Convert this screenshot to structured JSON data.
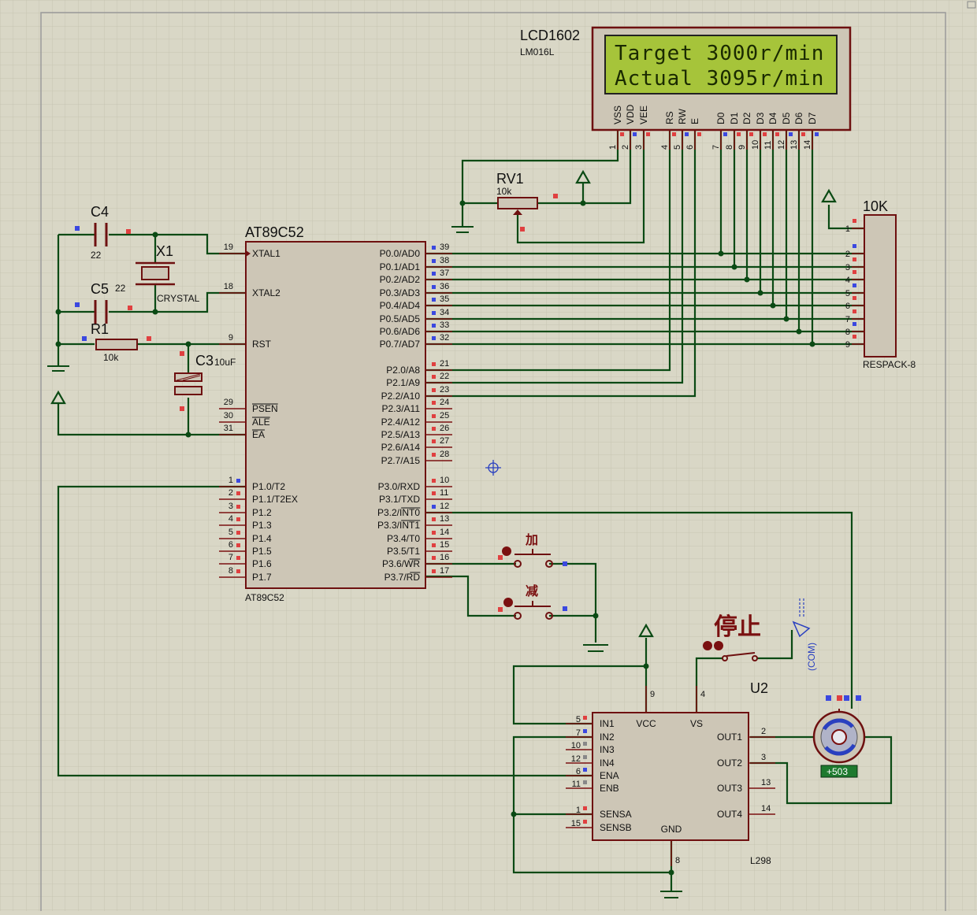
{
  "mcu": {
    "designator": "AT89C52",
    "part": "AT89C52",
    "left_pins": [
      {
        "num": "19",
        "name": "XTAL1"
      },
      {
        "num": "18",
        "name": "XTAL2"
      },
      {
        "num": "9",
        "name": "RST"
      },
      {
        "num": "29",
        "name": "PSEN"
      },
      {
        "num": "30",
        "name": "ALE"
      },
      {
        "num": "31",
        "name": "EA"
      },
      {
        "num": "1",
        "name": "P1.0/T2"
      },
      {
        "num": "2",
        "name": "P1.1/T2EX"
      },
      {
        "num": "3",
        "name": "P1.2"
      },
      {
        "num": "4",
        "name": "P1.3"
      },
      {
        "num": "5",
        "name": "P1.4"
      },
      {
        "num": "6",
        "name": "P1.5"
      },
      {
        "num": "7",
        "name": "P1.6"
      },
      {
        "num": "8",
        "name": "P1.7"
      }
    ],
    "right_pins": [
      {
        "num": "39",
        "name": "P0.0/AD0"
      },
      {
        "num": "38",
        "name": "P0.1/AD1"
      },
      {
        "num": "37",
        "name": "P0.2/AD2"
      },
      {
        "num": "36",
        "name": "P0.3/AD3"
      },
      {
        "num": "35",
        "name": "P0.4/AD4"
      },
      {
        "num": "34",
        "name": "P0.5/AD5"
      },
      {
        "num": "33",
        "name": "P0.6/AD6"
      },
      {
        "num": "32",
        "name": "P0.7/AD7"
      },
      {
        "num": "21",
        "name": "P2.0/A8"
      },
      {
        "num": "22",
        "name": "P2.1/A9"
      },
      {
        "num": "23",
        "name": "P2.2/A10"
      },
      {
        "num": "24",
        "name": "P2.3/A11"
      },
      {
        "num": "25",
        "name": "P2.4/A12"
      },
      {
        "num": "26",
        "name": "P2.5/A13"
      },
      {
        "num": "27",
        "name": "P2.6/A14"
      },
      {
        "num": "28",
        "name": "P2.7/A15"
      },
      {
        "num": "10",
        "name": "P3.0/RXD"
      },
      {
        "num": "11",
        "name": "P3.1/TXD"
      },
      {
        "num": "12",
        "name": "P3.2/INT0"
      },
      {
        "num": "13",
        "name": "P3.3/INT1"
      },
      {
        "num": "14",
        "name": "P3.4/T0"
      },
      {
        "num": "15",
        "name": "P3.5/T1"
      },
      {
        "num": "16",
        "name": "P3.6/WR"
      },
      {
        "num": "17",
        "name": "P3.7/RD"
      }
    ]
  },
  "lcd": {
    "designator": "LCD1602",
    "part": "LM016L",
    "line1": "Target 3000r/min",
    "line2": "Actual 3095r/min",
    "pins": [
      {
        "num": "1",
        "name": "VSS"
      },
      {
        "num": "2",
        "name": "VDD"
      },
      {
        "num": "3",
        "name": "VEE"
      },
      {
        "num": "4",
        "name": "RS"
      },
      {
        "num": "5",
        "name": "RW"
      },
      {
        "num": "6",
        "name": "E"
      },
      {
        "num": "7",
        "name": "D0"
      },
      {
        "num": "8",
        "name": "D1"
      },
      {
        "num": "9",
        "name": "D2"
      },
      {
        "num": "10",
        "name": "D3"
      },
      {
        "num": "11",
        "name": "D4"
      },
      {
        "num": "12",
        "name": "D5"
      },
      {
        "num": "13",
        "name": "D6"
      },
      {
        "num": "14",
        "name": "D7"
      }
    ]
  },
  "rv1": {
    "designator": "RV1",
    "value": "10k"
  },
  "respack": {
    "designator": "10K",
    "part": "RESPACK-8",
    "pins": [
      "1",
      "2",
      "3",
      "4",
      "5",
      "6",
      "7",
      "8",
      "9"
    ]
  },
  "c4": {
    "designator": "C4",
    "value": "22"
  },
  "c5": {
    "designator": "C5",
    "value": "22"
  },
  "x1": {
    "designator": "X1",
    "value": "CRYSTAL"
  },
  "r1": {
    "designator": "R1",
    "value": "10k"
  },
  "c3": {
    "designator": "C3",
    "value": "10uF"
  },
  "buttons": {
    "up": "加",
    "down": "减",
    "stop": "停止",
    "com": "(COM)"
  },
  "driver": {
    "designator": "U2",
    "part": "L298",
    "left_pins": [
      {
        "num": "5",
        "name": "IN1"
      },
      {
        "num": "7",
        "name": "IN2"
      },
      {
        "num": "10",
        "name": "IN3"
      },
      {
        "num": "12",
        "name": "IN4"
      },
      {
        "num": "6",
        "name": "ENA"
      },
      {
        "num": "11",
        "name": "ENB"
      },
      {
        "num": "1",
        "name": "SENSA"
      },
      {
        "num": "15",
        "name": "SENSB"
      }
    ],
    "right_pins": [
      {
        "num": "2",
        "name": "OUT1"
      },
      {
        "num": "3",
        "name": "OUT2"
      },
      {
        "num": "13",
        "name": "OUT3"
      },
      {
        "num": "14",
        "name": "OUT4"
      }
    ],
    "top_pins": [
      {
        "num": "9",
        "name": "VCC"
      },
      {
        "num": "4",
        "name": "VS"
      }
    ],
    "bottom_pin": {
      "num": "8",
      "name": "GND"
    }
  },
  "motor": {
    "readout": "+503"
  },
  "colors": {
    "wire": "#0b4a14",
    "component": "#6e1010",
    "lcd_screen": "#a6c43a",
    "background": "#d9d7c6"
  }
}
